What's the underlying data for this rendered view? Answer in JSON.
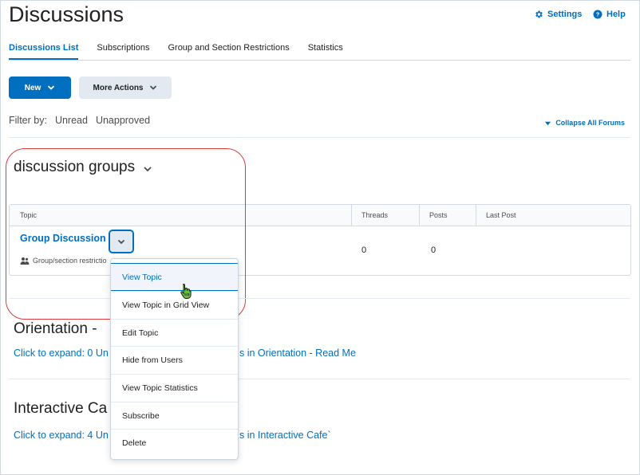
{
  "header": {
    "title": "Discussions",
    "settings_label": "Settings",
    "help_label": "Help"
  },
  "tabs": [
    {
      "label": "Discussions List",
      "active": true
    },
    {
      "label": "Subscriptions",
      "active": false
    },
    {
      "label": "Group and Section Restrictions",
      "active": false
    },
    {
      "label": "Statistics",
      "active": false
    }
  ],
  "toolbar": {
    "new_label": "New",
    "more_actions_label": "More Actions"
  },
  "filter": {
    "label": "Filter by:",
    "options": [
      "Unread",
      "Unapproved"
    ],
    "collapse_label": "Collapse All Forums"
  },
  "forums": [
    {
      "title": "discussion groups",
      "table": {
        "headers": [
          "Topic",
          "Threads",
          "Posts",
          "Last Post"
        ],
        "rows": [
          {
            "topic": "Group Discussion",
            "restriction": "Group/section restrictio",
            "threads": "0",
            "posts": "0",
            "last_post": ""
          }
        ]
      }
    },
    {
      "title": "Orientation -",
      "expand_left": "Click to expand: 0 Un",
      "expand_right": "s in Orientation - Read Me"
    },
    {
      "title": "Interactive Ca",
      "expand_left": "Click to expand: 4 Un",
      "expand_right": "s in Interactive Cafe`"
    }
  ],
  "context_menu": {
    "items": [
      "View Topic",
      "View Topic in Grid View",
      "Edit Topic",
      "Hide from Users",
      "View Topic Statistics",
      "Subscribe",
      "Delete"
    ],
    "active_item": "View Topic"
  },
  "colors": {
    "accent": "#006fbf",
    "highlight_outline": "#e0393e",
    "cursor_green": "#4caf50"
  }
}
